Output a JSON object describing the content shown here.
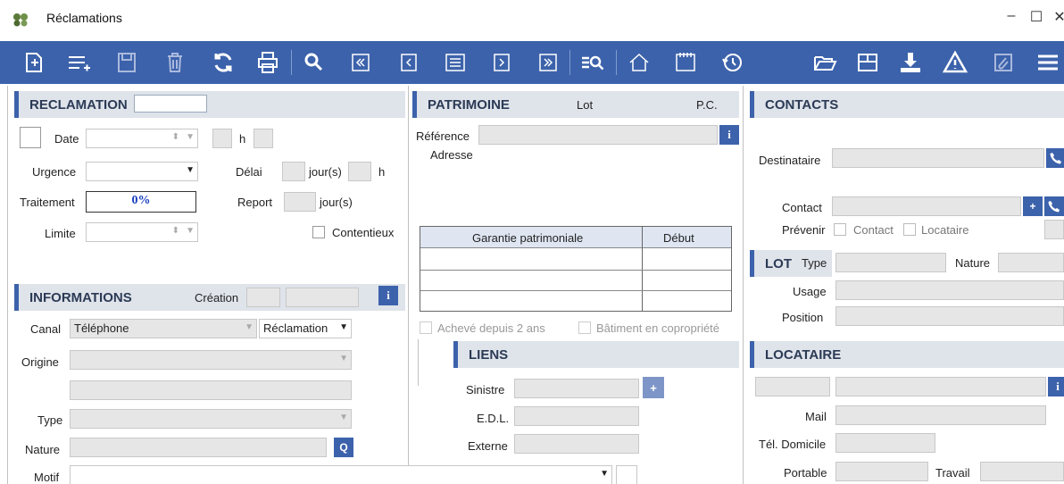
{
  "window": {
    "title": "Réclamations",
    "minimize": "–",
    "maximize": "☐",
    "close": "✕"
  },
  "reclamation": {
    "header": "RECLAMATION",
    "date_label": "Date",
    "h_label": "h",
    "urgence_label": "Urgence",
    "delai_label": "Délai",
    "jours_label": "jour(s)",
    "h2_label": "h",
    "traitement_label": "Traitement",
    "traitement_value": "0%",
    "report_label": "Report",
    "report_jours_label": "jour(s)",
    "limite_label": "Limite",
    "contentieux_label": "Contentieux"
  },
  "informations": {
    "header": "INFORMATIONS",
    "creation_label": "Création",
    "canal_label": "Canal",
    "canal_value": "Téléphone",
    "canal_type_value": "Réclamation",
    "origine_label": "Origine",
    "type_label": "Type",
    "nature_label": "Nature",
    "motif_label": "Motif"
  },
  "patrimoine": {
    "header": "PATRIMOINE",
    "lot_label": "Lot",
    "pc_label": "P.C.",
    "reference_label": "Référence",
    "adresse_label": "Adresse",
    "table_columns": [
      "Garantie patrimoniale",
      "Début"
    ],
    "acheve_label": "Achevé depuis 2 ans",
    "batiment_label": "Bâtiment en copropriété"
  },
  "liens": {
    "header": "LIENS",
    "sinistre_label": "Sinistre",
    "edl_label": "E.D.L.",
    "externe_label": "Externe"
  },
  "contacts": {
    "header": "CONTACTS",
    "destinataire_label": "Destinataire",
    "contact_label": "Contact",
    "prevenir_label": "Prévenir",
    "prevenir_contact_label": "Contact",
    "prevenir_locataire_label": "Locataire"
  },
  "lot": {
    "header": "LOT",
    "type_label": "Type",
    "nature_label": "Nature",
    "usage_label": "Usage",
    "position_label": "Position"
  },
  "locataire": {
    "header": "LOCATAIRE",
    "mail_label": "Mail",
    "tel_domicile_label": "Tél. Domicile",
    "portable_label": "Portable",
    "travail_label": "Travail"
  },
  "icons": {
    "info": "i",
    "search": "Q",
    "plus": "+"
  },
  "colors": {
    "accent": "#3c62ab",
    "section_bg": "#dfe3ea",
    "field_bg": "#e6e6e6",
    "percent": "#1a3fbf"
  }
}
